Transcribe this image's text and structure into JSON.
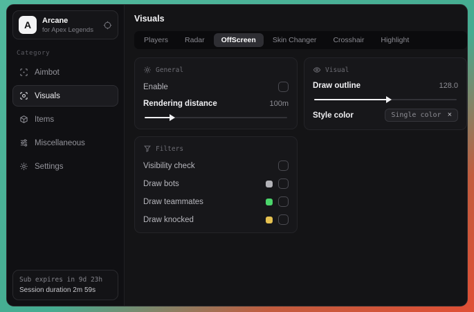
{
  "app": {
    "logo_letter": "A",
    "name": "Arcane",
    "subtitle": "for Apex Legends"
  },
  "sidebar": {
    "category_label": "Category",
    "items": [
      {
        "label": "Aimbot",
        "icon": "aimbot-icon",
        "selected": false
      },
      {
        "label": "Visuals",
        "icon": "visuals-icon",
        "selected": true
      },
      {
        "label": "Items",
        "icon": "items-icon",
        "selected": false
      },
      {
        "label": "Miscellaneous",
        "icon": "miscellaneous-icon",
        "selected": false
      },
      {
        "label": "Settings",
        "icon": "settings-icon",
        "selected": false
      }
    ],
    "footer": {
      "subscription": "Sub expires in 9d 23h",
      "session": "Session duration 2m 59s"
    }
  },
  "main": {
    "title": "Visuals",
    "tabs": [
      {
        "label": "Players",
        "selected": false
      },
      {
        "label": "Radar",
        "selected": false
      },
      {
        "label": "OffScreen",
        "selected": true
      },
      {
        "label": "Skin Changer",
        "selected": false
      },
      {
        "label": "Crosshair",
        "selected": false
      },
      {
        "label": "Highlight",
        "selected": false
      }
    ]
  },
  "panels": {
    "general": {
      "title": "General",
      "enable_label": "Enable",
      "enable_checked": false,
      "distance_label": "Rendering distance",
      "distance_value": "100m",
      "distance_fill": "18%"
    },
    "visual": {
      "title": "Visual",
      "outline_label": "Draw outline",
      "outline_value": "128.0",
      "outline_fill": "51%",
      "style_label": "Style color",
      "style_value": "Single color",
      "style_clear": "×"
    },
    "filters": {
      "title": "Filters",
      "rows": [
        {
          "label": "Visibility check",
          "swatch": null,
          "checked": false
        },
        {
          "label": "Draw bots",
          "swatch": "#b3b3b8",
          "checked": false
        },
        {
          "label": "Draw teammates",
          "swatch": "#4bd56b",
          "checked": false
        },
        {
          "label": "Draw knocked",
          "swatch": "#e5c150",
          "checked": false
        }
      ]
    }
  },
  "colors": {
    "desktop_teal": "#45ac91",
    "desktop_red": "#e04f35",
    "accent_white": "#f1f1f3"
  }
}
